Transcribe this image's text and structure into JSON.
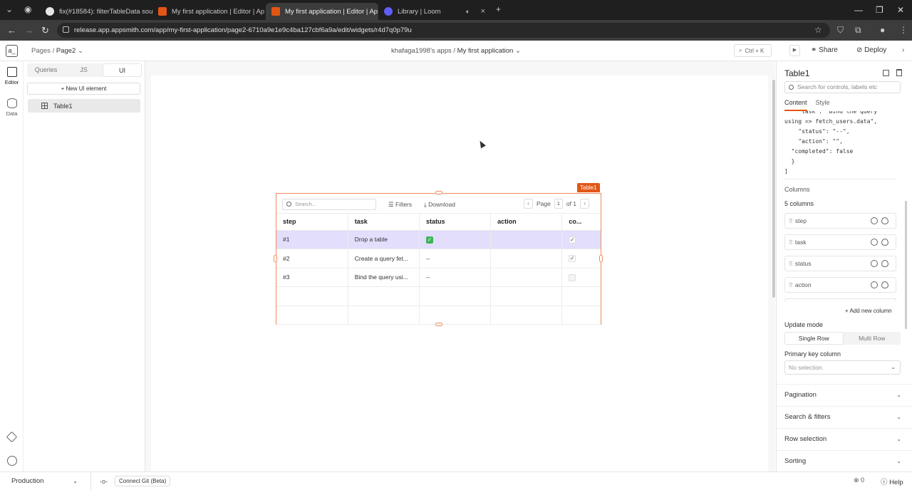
{
  "browser": {
    "tabs": [
      {
        "title": "fix(#18584): filterTableData sou",
        "icon_color": "#e6e6e6",
        "active": false
      },
      {
        "title": "My first application | Editor | Ap",
        "icon_color": "#e15615",
        "active": false
      },
      {
        "title": "My first application | Editor | Ap",
        "icon_color": "#e15615",
        "active": true
      },
      {
        "title": "Library | Loom",
        "icon_color": "#625df5",
        "active": false
      }
    ],
    "url": "release.app.appsmith.com/app/my-first-application/page2-6710a9e1e9c4ba127cbf6a9a/edit/widgets/r4d7q0p79u"
  },
  "header": {
    "pages_label": "Pages",
    "current_page": "Page2",
    "workspace": "khafaga1998's apps",
    "app_name": "My first application",
    "search_shortcut": "Ctrl + K",
    "share_label": "Share",
    "deploy_label": "Deploy",
    "logo_text": "a_"
  },
  "rail": {
    "editor_label": "Editor",
    "data_label": "Data"
  },
  "explorer": {
    "segments": [
      "Queries",
      "JS",
      "UI"
    ],
    "active_segment": "UI",
    "new_ui_label": "+ New UI element",
    "entities": [
      "Table1"
    ]
  },
  "table": {
    "widget_name": "Table1",
    "search_placeholder": "Search...",
    "filters_label": "Filters",
    "download_label": "Download",
    "page_label": "Page",
    "page_number": "1",
    "page_total": "of 1",
    "columns": [
      "step",
      "task",
      "status",
      "action",
      "co..."
    ],
    "rows": [
      {
        "step": "#1",
        "task": "Drop a table",
        "status": "check",
        "action": "",
        "completed": "checked-green",
        "selected": true
      },
      {
        "step": "#2",
        "task": "Create a query fet...",
        "status": "--",
        "action": "",
        "completed": "checked",
        "selected": false
      },
      {
        "step": "#3",
        "task": "Bind the query usi...",
        "status": "--",
        "action": "",
        "completed": "unchecked",
        "selected": false
      }
    ]
  },
  "props": {
    "title": "Table1",
    "search_placeholder": "Search for controls, labels etc",
    "tabs": [
      "Content",
      "Style"
    ],
    "active_tab": "Content",
    "code_lines": [
      "    \"task\": \"Bind the query",
      "using => fetch_users.data\",",
      "    \"status\": \"--\",",
      "    \"action\": \"\",",
      "  \"completed\": false",
      "  }",
      "]"
    ],
    "columns_label": "Columns",
    "columns_count": "5 columns",
    "column_items": [
      "step",
      "task",
      "status",
      "action"
    ],
    "add_column_label": "+ Add new column",
    "update_mode_label": "Update mode",
    "update_modes": [
      "Single Row",
      "Multi Row"
    ],
    "primary_key_label": "Primary key column",
    "primary_key_placeholder": "No selection.",
    "sections": [
      "Pagination",
      "Search & filters",
      "Row selection",
      "Sorting"
    ]
  },
  "bottombar": {
    "environment": "Production",
    "git_label": "Connect Git (Beta)",
    "error_count": "0",
    "help_label": "Help"
  }
}
